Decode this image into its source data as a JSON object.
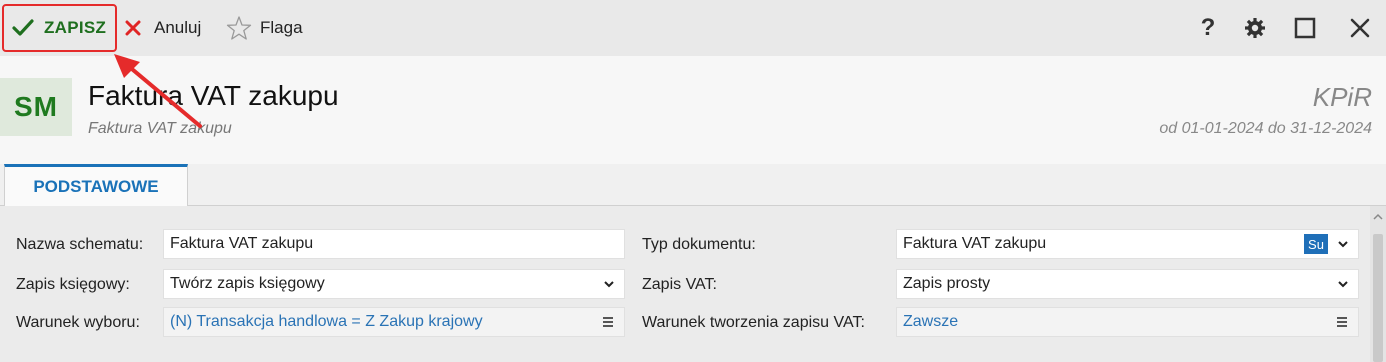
{
  "toolbar": {
    "save_label": "ZAPISZ",
    "cancel_label": "Anuluj",
    "flag_label": "Flaga",
    "help_label": "?"
  },
  "header": {
    "avatar": "SM",
    "title": "Faktura VAT zakupu",
    "subtitle": "Faktura VAT zakupu",
    "module": "KPiR",
    "period": "od 01-01-2024 do 31-12-2024"
  },
  "tabs": [
    {
      "label": "PODSTAWOWE"
    }
  ],
  "form": {
    "left": [
      {
        "label": "Nazwa schematu:",
        "value": "Faktura VAT zakupu"
      },
      {
        "label": "Zapis księgowy:",
        "value": "Twórz zapis księgowy"
      },
      {
        "label": "Warunek wyboru:",
        "value": "(N) Transakcja handlowa = Z Zakup krajowy"
      }
    ],
    "right": [
      {
        "label": "Typ dokumentu:",
        "value": "Faktura VAT zakupu",
        "badge": "Su"
      },
      {
        "label": "Zapis VAT:",
        "value": "Zapis prosty"
      },
      {
        "label": "Warunek tworzenia zapisu VAT:",
        "value": "Zawsze"
      }
    ]
  },
  "colors": {
    "save_accent": "#1f6f1f",
    "highlight": "#e52b2b",
    "link": "#2a73b5",
    "tab_accent": "#1a72b8",
    "badge": "#1f6fb8"
  },
  "icons": [
    "check-icon",
    "x-icon",
    "star-icon",
    "help-icon",
    "gear-icon",
    "maximize-icon",
    "close-icon",
    "chevron-down-icon",
    "menu-icon"
  ]
}
